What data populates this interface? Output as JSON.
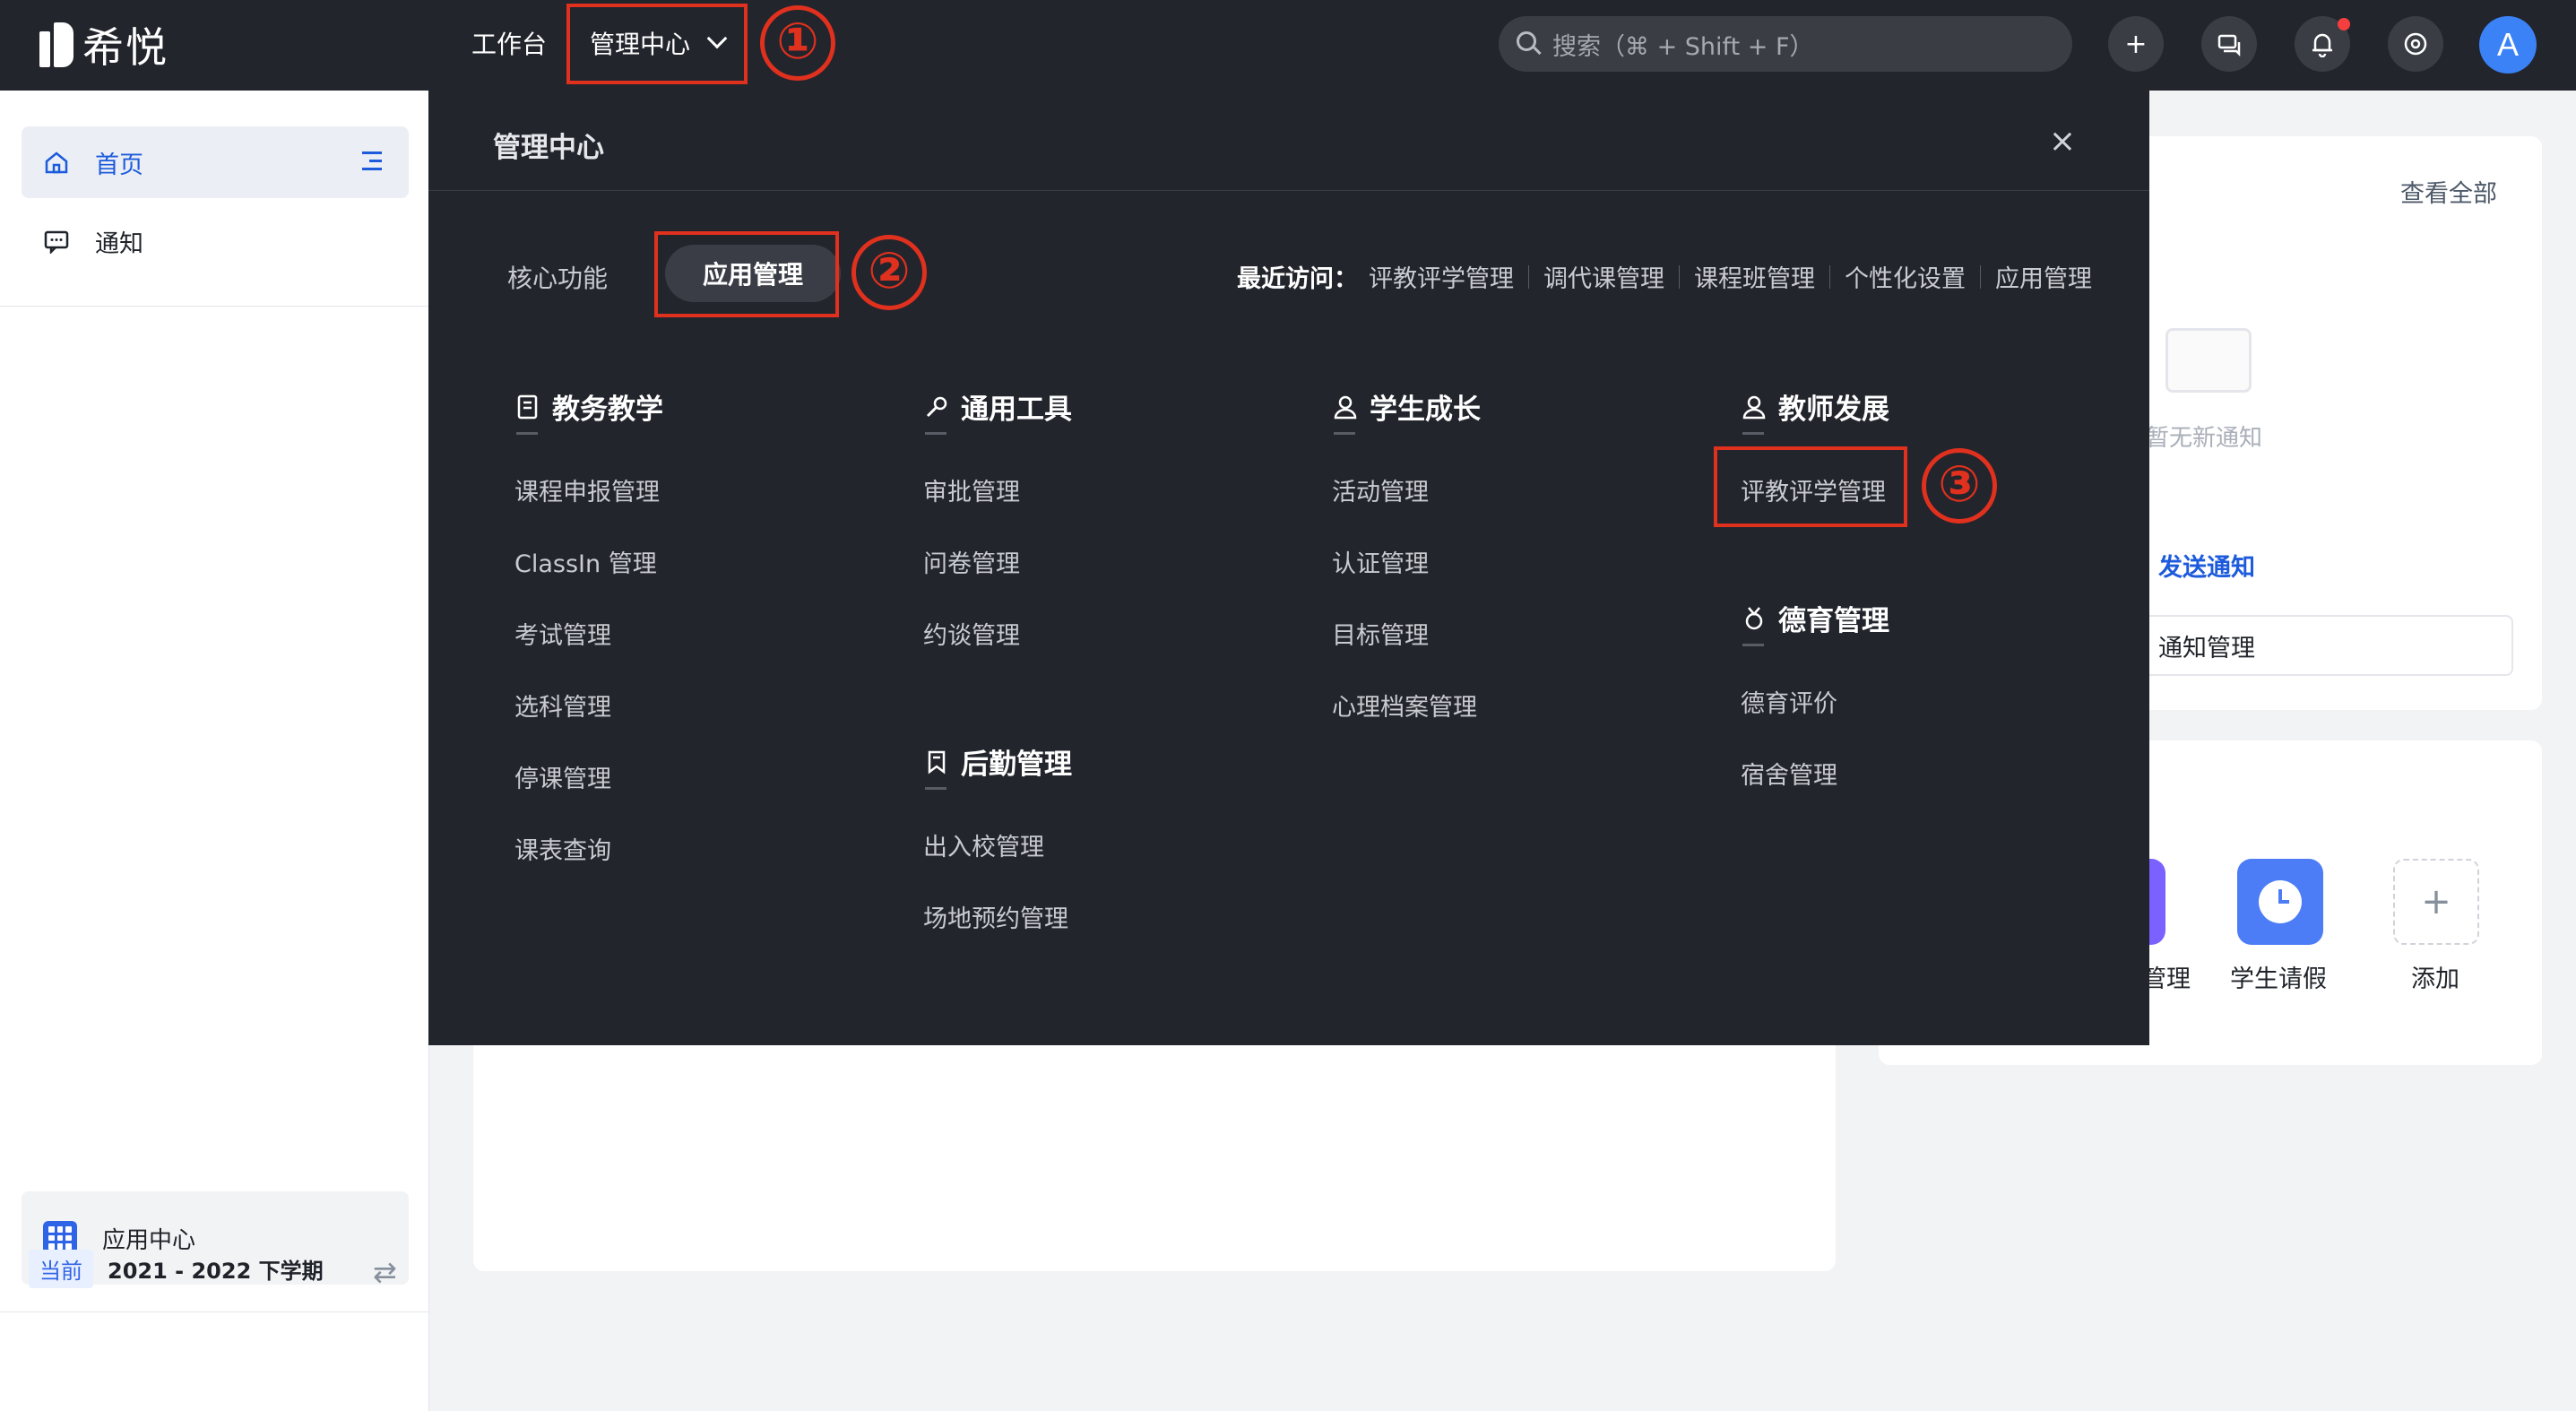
{
  "topbar": {
    "logo_text": "希悦",
    "nav_workbench": "工作台",
    "nav_admin": "管理中心",
    "search_placeholder": "搜索（⌘ + Shift + F）",
    "avatar_letter": "A",
    "annotation_1": "①"
  },
  "sidebar": {
    "home_label": "首页",
    "notice_label": "通知",
    "app_center_label": "应用中心",
    "term_tag": "当前",
    "term_value": "2021 - 2022 下学期"
  },
  "panel": {
    "title": "管理中心",
    "close_icon": "×",
    "tabs": {
      "core": "核心功能",
      "apps": "应用管理"
    },
    "annotation_2": "②",
    "annotation_3": "③",
    "recent_label": "最近访问：",
    "recent_items": [
      "评教评学管理",
      "调代课管理",
      "课程班管理",
      "个性化设置",
      "应用管理"
    ],
    "columns": {
      "teaching": {
        "title": "教务教学",
        "items": [
          "课程申报管理",
          "ClassIn 管理",
          "考试管理",
          "选科管理",
          "停课管理",
          "课表查询"
        ]
      },
      "tools": {
        "title": "通用工具",
        "items": [
          "审批管理",
          "问卷管理",
          "约谈管理"
        ]
      },
      "logistics": {
        "title": "后勤管理",
        "items": [
          "出入校管理",
          "场地预约管理"
        ]
      },
      "growth": {
        "title": "学生成长",
        "items": [
          "活动管理",
          "认证管理",
          "目标管理",
          "心理档案管理"
        ]
      },
      "teacher": {
        "title": "教师发展",
        "items": [
          "评教评学管理"
        ]
      },
      "moral": {
        "title": "德育管理",
        "items": [
          "德育评价",
          "宿舍管理"
        ]
      }
    }
  },
  "background": {
    "view_all": "查看全部",
    "empty_text": "暂无新通知",
    "send_notice": "发送通知",
    "notice_manage": "通知管理",
    "app_partial_label": "管理",
    "app_leave_label": "学生请假",
    "app_add_label": "添加"
  },
  "colors": {
    "topbar_bg": "#23252d",
    "panel_bg": "#23252d",
    "accent_blue": "#1d5bdc",
    "annotation_red": "#e0301e"
  }
}
